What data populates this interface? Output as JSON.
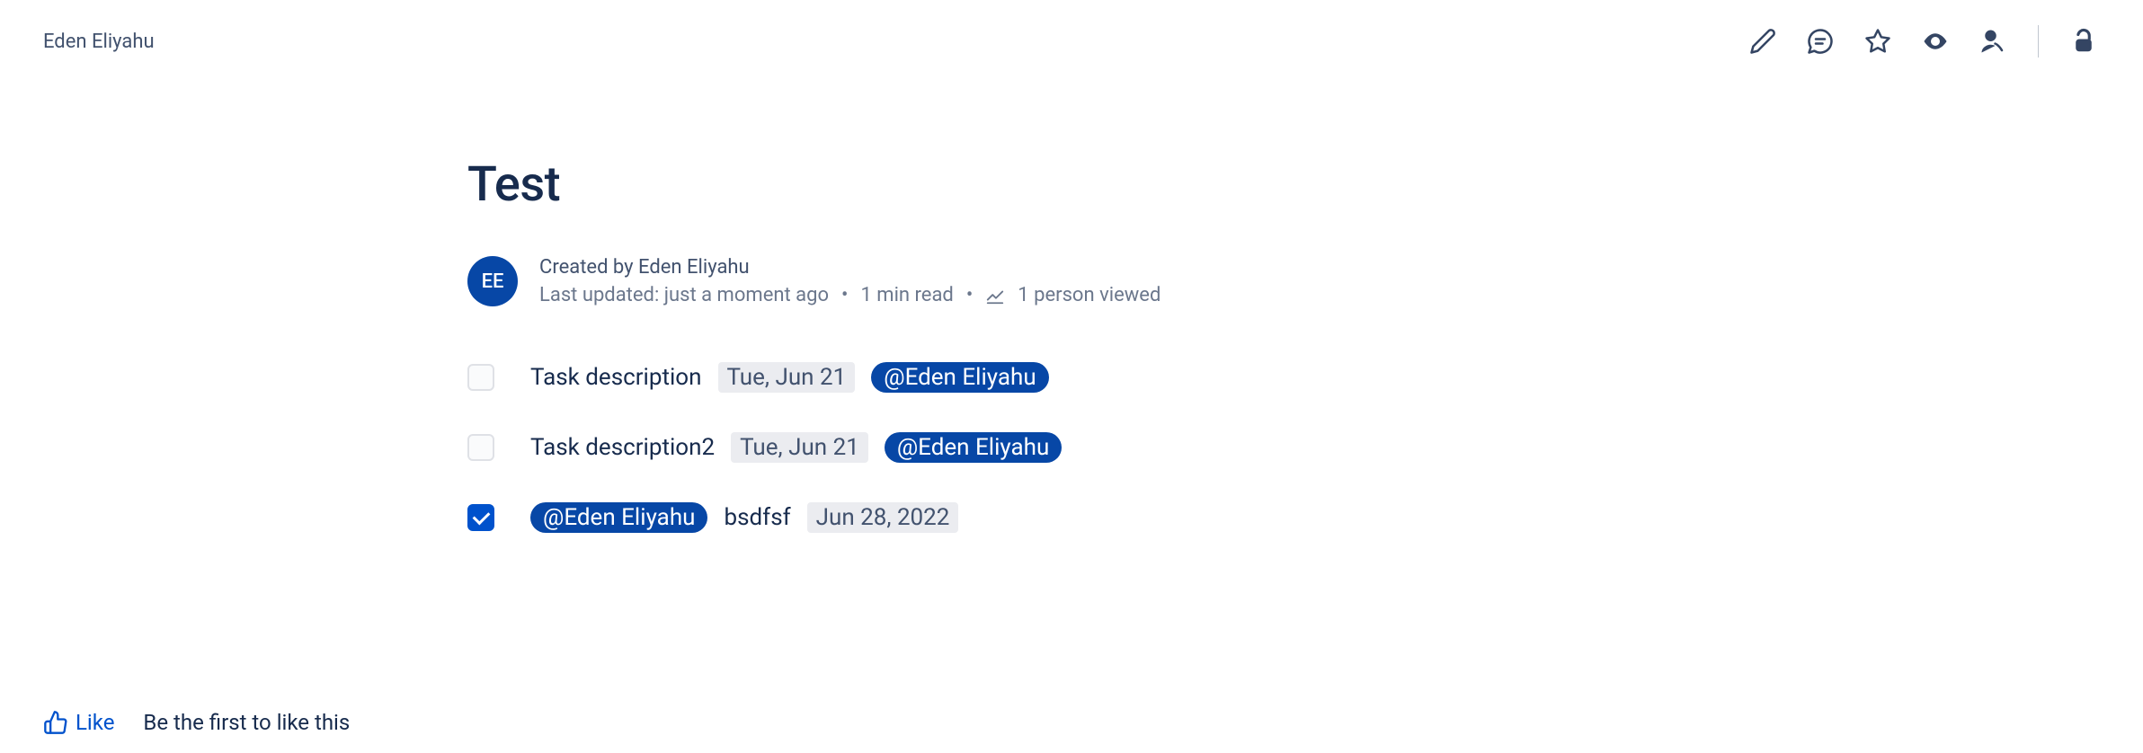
{
  "breadcrumb": "Eden Eliyahu",
  "page": {
    "title": "Test",
    "author_initials": "EE",
    "created_by": "Created by Eden Eliyahu",
    "last_updated": "Last updated: just a moment ago",
    "read_time": "1 min read",
    "views": "1 person viewed"
  },
  "tasks": [
    {
      "checked": false,
      "text": "Task description",
      "date": "Tue, Jun 21",
      "mention": "@Eden Eliyahu",
      "order": "text-date-mention"
    },
    {
      "checked": false,
      "text": "Task description2",
      "date": "Tue, Jun 21",
      "mention": "@Eden Eliyahu",
      "order": "text-date-mention"
    },
    {
      "checked": true,
      "text": "bsdfsf",
      "date": "Jun 28, 2022",
      "mention": "@Eden Eliyahu",
      "order": "mention-text-date"
    }
  ],
  "like": {
    "label": "Like",
    "hint": "Be the first to like this"
  }
}
